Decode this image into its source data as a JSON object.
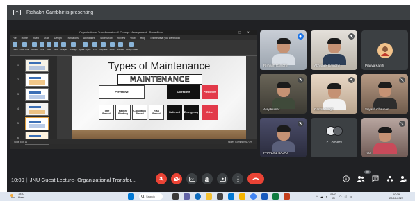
{
  "meeting": {
    "presenter_text": "Rishabh Gambhir is presenting",
    "time": "10:09",
    "title": "JNU Guest Lecture- Organizational Transfor..."
  },
  "ppt": {
    "doc_title": "Organizational Transformation & Change Management - PowerPoint",
    "tabs": [
      "File",
      "Home",
      "Insert",
      "Draw",
      "Design",
      "Transitions",
      "Animations",
      "Slide Show",
      "Review",
      "View",
      "Help",
      "Tell me what you want to do"
    ],
    "ribbon_items": [
      "Paste",
      "New Slide",
      "Reuse",
      "Font",
      "Bold",
      "Italic",
      "Shapes",
      "Arrange",
      "Quick Styles",
      "Find",
      "Replace",
      "Select",
      "Dictate",
      "Design Ideas"
    ],
    "slide_numbers": [
      "1",
      "2",
      "3",
      "4",
      "5",
      "6",
      "7"
    ],
    "status_left": "Slide 5 of 11",
    "status_right": "Notes  Comments  73%"
  },
  "slide": {
    "title": "Types of Maintenance",
    "maintenance": "MAINTENANCE",
    "boxes": [
      {
        "id": "preventive",
        "text": "Preventive",
        "style": "w"
      },
      {
        "id": "corrective",
        "text": "Corrective",
        "style": "k"
      },
      {
        "id": "predictive",
        "text": "Predictive",
        "style": "r"
      },
      {
        "id": "time-based",
        "text": "Time Based",
        "style": "w"
      },
      {
        "id": "failure-finding",
        "text": "Failure Finding",
        "style": "w"
      },
      {
        "id": "condition-based",
        "text": "Condition Based",
        "style": "w"
      },
      {
        "id": "risk-based",
        "text": "Risk Based",
        "style": "w"
      },
      {
        "id": "deferred",
        "text": "Deferred",
        "style": "k"
      },
      {
        "id": "emergency",
        "text": "Emergency",
        "style": "k"
      },
      {
        "id": "other",
        "text": "Other",
        "style": "r"
      }
    ]
  },
  "participants": [
    {
      "name": "Rishabh Gambhir",
      "speaking": true
    },
    {
      "name": "Abhishek Gambhir",
      "speaking": false
    },
    {
      "name": "Pragya Kanth",
      "speaking": false
    },
    {
      "name": "Ajay Kumar",
      "speaking": false
    },
    {
      "name": "Garima Singh",
      "speaking": false
    },
    {
      "name": "Suyash Chauhan",
      "speaking": false
    },
    {
      "name": "PRANJAL BAJAJ",
      "speaking": false
    },
    {
      "name": "21 others",
      "speaking": false
    },
    {
      "name": "You",
      "speaking": false
    }
  ],
  "controls": {
    "participant_count": "30"
  },
  "taskbar": {
    "weather_temp": "18°C",
    "weather_desc": "Haze",
    "search_label": "Search",
    "lang": "ENG",
    "region": "IN",
    "time": "10:09",
    "date": "23-11-2022"
  },
  "colors": {
    "meet_bg": "#202124",
    "hangup_red": "#ea4335",
    "speaking_blue": "#1a73e8"
  }
}
